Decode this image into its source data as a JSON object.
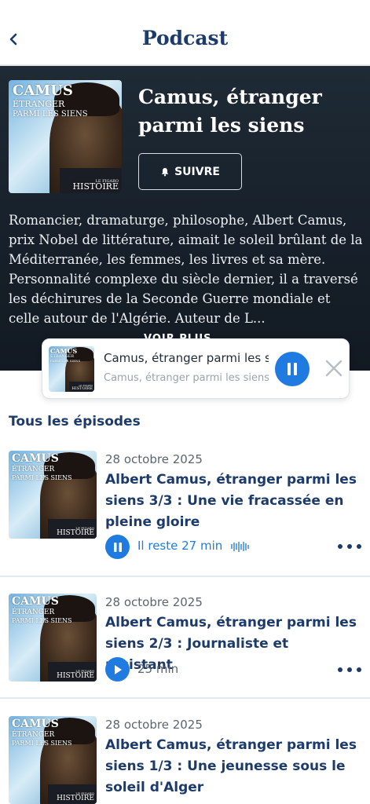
{
  "header": {
    "title": "Podcast"
  },
  "podcast": {
    "cover": {
      "title_line1": "CAMUS",
      "title_line2": "ÉTRANGER",
      "title_line3": "PARMI LES SIENS",
      "brand_small": "LE FIGARO",
      "brand": "HISTOIRE"
    },
    "title": "Camus, étranger parmi les siens",
    "follow_label": "SUIVRE",
    "description": "Romancier, dramaturge, philosophe, Albert Camus, prix Nobel de littérature, aimait le soleil brûlant de la Méditerranée, les femmes, les livres et sa mère. Personnalité complexe du siècle dernier, il a traversé les déchirures de la Seconde Guerre mondiale et celle autour de l'Algérie. Auteur de L...",
    "voir_plus": "VOIR PLUS"
  },
  "mini_player": {
    "title": "Camus, étranger parmi les siens",
    "subtitle": "Camus, étranger parmi les siens"
  },
  "episodes_section": {
    "title": "Tous les épisodes"
  },
  "episodes": [
    {
      "date": "28 octobre 2025",
      "title": "Albert Camus, étranger parmi les siens 3/3 : Une vie fracassée en pleine gloire",
      "duration": "Il reste 27 min",
      "state": "playing"
    },
    {
      "date": "28 octobre 2025",
      "title": "Albert Camus, étranger parmi les siens 2/3 : Journaliste et résistant",
      "duration": "25 min",
      "state": "paused"
    },
    {
      "date": "28 octobre 2025",
      "title": "Albert Camus, étranger parmi les siens 1/3 : Une jeunesse sous le soleil d'Alger",
      "duration": "",
      "state": "paused"
    }
  ],
  "colors": {
    "accent": "#1f7be0",
    "navy": "#1c3b6b",
    "hero_bg": "#18212b"
  },
  "icons": {
    "back": "chevron-left-icon",
    "bell": "bell-icon",
    "pause": "pause-icon",
    "play": "play-icon",
    "close": "close-icon",
    "more": "more-horizontal-icon",
    "wave": "waveform-icon"
  }
}
